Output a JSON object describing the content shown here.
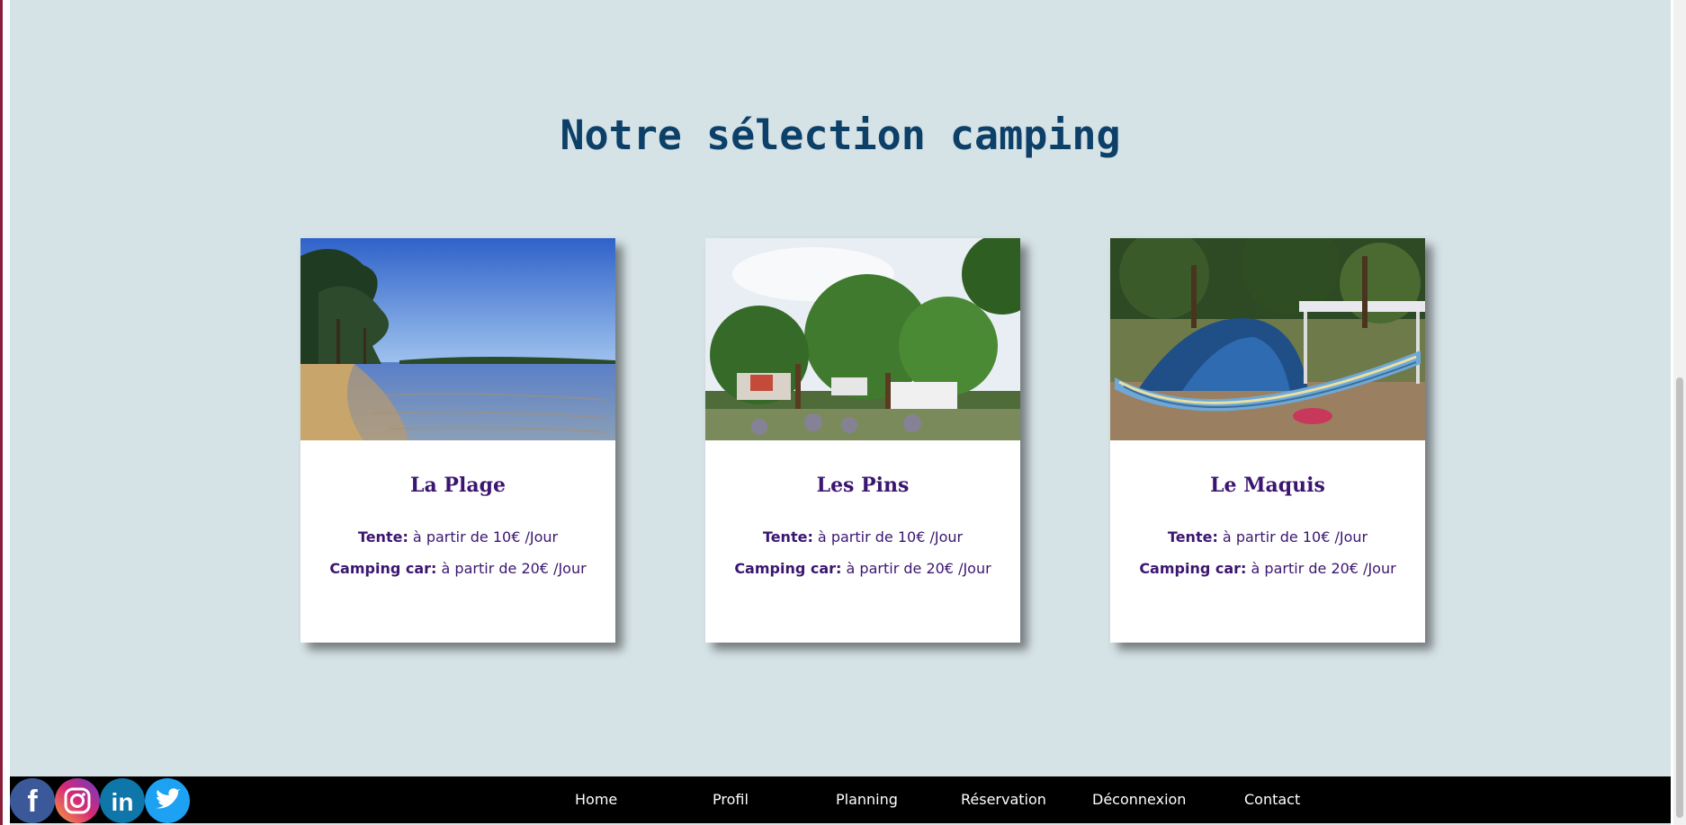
{
  "page": {
    "title": "Notre sélection camping"
  },
  "cards": [
    {
      "name": "La Plage",
      "tent_label": "Tente:",
      "tent_price": " à partir de 10€ /Jour",
      "cc_label": "Camping car:",
      "cc_price": " à partir de 20€ /Jour"
    },
    {
      "name": "Les Pins",
      "tent_label": "Tente:",
      "tent_price": " à partir de 10€ /Jour",
      "cc_label": "Camping car:",
      "cc_price": " à partir de 20€ /Jour"
    },
    {
      "name": "Le Maquis",
      "tent_label": "Tente:",
      "tent_price": " à partir de 10€ /Jour",
      "cc_label": "Camping car:",
      "cc_price": " à partir de 20€ /Jour"
    }
  ],
  "footer": {
    "social": [
      "facebook-icon",
      "instagram-icon",
      "linkedin-icon",
      "twitter-icon"
    ],
    "nav": [
      "Home",
      "Profil",
      "Planning",
      "Réservation",
      "Déconnexion",
      "Contact"
    ]
  },
  "colors": {
    "background": "#d5e2e6",
    "title": "#0d4068",
    "card_text": "#3b1670",
    "footer": "#000000"
  }
}
